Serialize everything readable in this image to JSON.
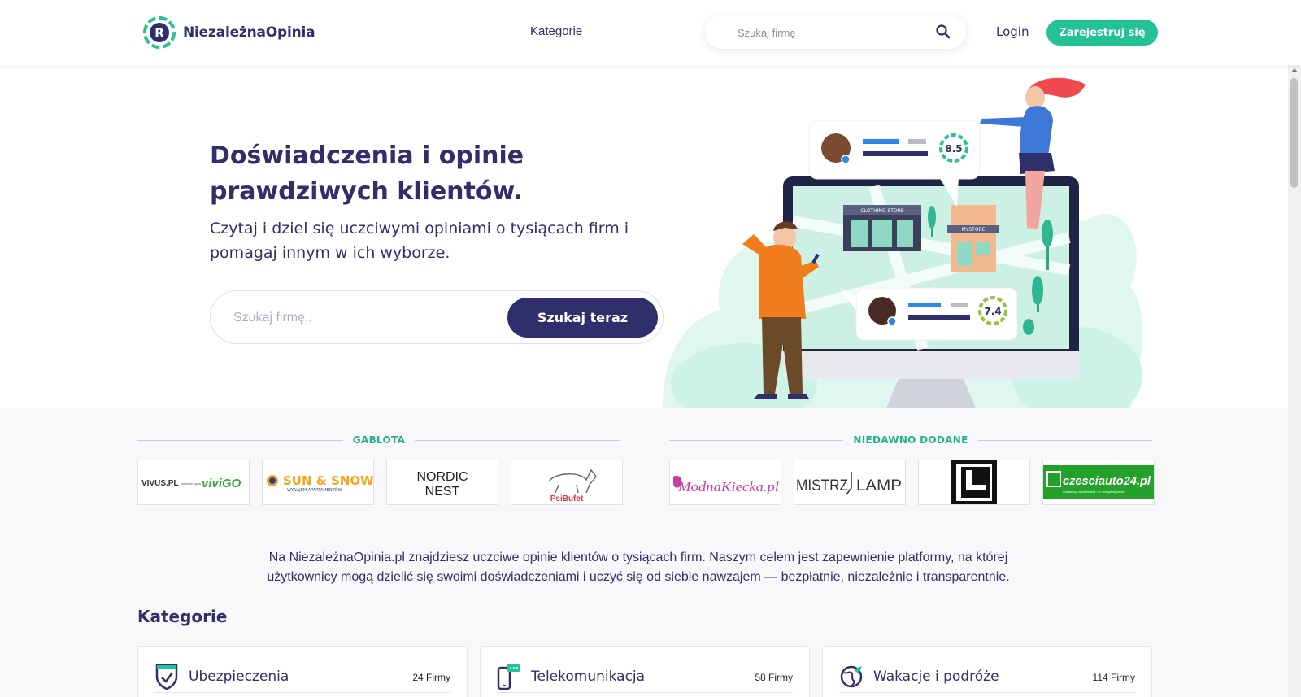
{
  "header": {
    "brand": "NiezależnaOpinia",
    "nav_categories": "Kategorie",
    "search_placeholder": "Szukaj firmę",
    "login": "Login",
    "register": "Zarejestruj się"
  },
  "hero": {
    "title_line1": "Doświadczenia i opinie",
    "title_line2": "prawdziwych klientów.",
    "subtitle": "Czytaj i dziel się uczciwymi opiniami o tysiącach firm i pomagaj innym w ich wyborze.",
    "search_placeholder": "Szukaj firmę..",
    "search_button": "Szukaj teraz",
    "illustration": {
      "rating_top": "8.5",
      "rating_bottom": "7.4",
      "store_sign_1": "CLOTHING STORE",
      "store_sign_2": "MYSTORE"
    }
  },
  "gablota": {
    "heading": "GABLOTA",
    "logos": [
      {
        "name": "vivus-vivigo",
        "text_a": "VIVUS.PL",
        "text_b": "zmienia się w",
        "text_c": "viviGO"
      },
      {
        "name": "sun-and-snow",
        "text_a": "SUN & SNOW",
        "text_b": "WYNAJEM APARTAMENTÓW"
      },
      {
        "name": "nordic-nest",
        "text_a": "NORDIC",
        "text_b": "NEST"
      },
      {
        "name": "psibufet",
        "text_a": "PsiBufet"
      }
    ]
  },
  "recent": {
    "heading": "NIEDAWNO DODANE",
    "logos": [
      {
        "name": "modnakiecka",
        "text_a": "ModnaKiecka.pl"
      },
      {
        "name": "mistrz-lamp",
        "text_a": "MISTRZ",
        "text_b": "LAMP"
      },
      {
        "name": "l-brand",
        "text_a": "L"
      },
      {
        "name": "czesciauto24",
        "text_a": "czesciauto24.pl",
        "text_b": "dostawcy, oczekiwania i w rozsądnej cenie!"
      }
    ]
  },
  "intro": "Na NiezależnaOpinia.pl znajdziesz uczciwe opinie klientów o tysiącach firm. Naszym celem jest zapewnienie platformy, na której użytkownicy mogą dzielić się swoimi doświadczeniami i uczyć się od siebie nawzajem — bezpłatnie, niezależnie i transparentnie.",
  "categories": {
    "title": "Kategorie",
    "items": [
      {
        "name": "Ubezpieczenia",
        "count": "24 Firmy",
        "icon": "shield-check-icon"
      },
      {
        "name": "Telekomunikacja",
        "count": "58 Firmy",
        "icon": "phone-chat-icon"
      },
      {
        "name": "Wakacje i podróże",
        "count": "114 Firmy",
        "icon": "globe-plane-icon"
      }
    ]
  },
  "colors": {
    "primary": "#2e2f6b",
    "accent": "#22c295",
    "section_heading": "#22b28a"
  }
}
